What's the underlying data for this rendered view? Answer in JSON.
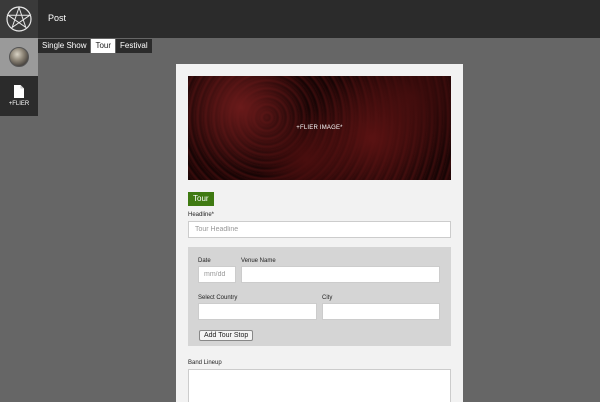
{
  "topbar": {
    "title": "Post"
  },
  "sidebar": {
    "logo_icon": "pentagram-icon",
    "avatar_icon": "user-avatar",
    "flier_icon": "document-icon",
    "flier_label": "+FLIER"
  },
  "tabs": [
    {
      "label": "Single Show",
      "active": false
    },
    {
      "label": "Tour",
      "active": true
    },
    {
      "label": "Festival",
      "active": false
    }
  ],
  "form": {
    "flier_image_text": "+FLIER IMAGE*",
    "mode_badge": "Tour",
    "headline_label": "Headline*",
    "headline_placeholder": "Tour Headline",
    "headline_value": "",
    "stop": {
      "date_label": "Date",
      "date_placeholder": "mm/dd",
      "venue_label": "Venue Name",
      "venue_value": "",
      "country_label": "Select Country",
      "country_value": "",
      "city_label": "City",
      "city_value": "",
      "add_stop_label": "Add Tour Stop"
    },
    "lineup_label": "Band Lineup",
    "lineup_value": ""
  },
  "colors": {
    "background": "#666666",
    "topbar": "#2b2b2b",
    "accent_green": "#3f7a12",
    "card": "#f2f2f2",
    "stop_box": "#d5d5d5"
  }
}
